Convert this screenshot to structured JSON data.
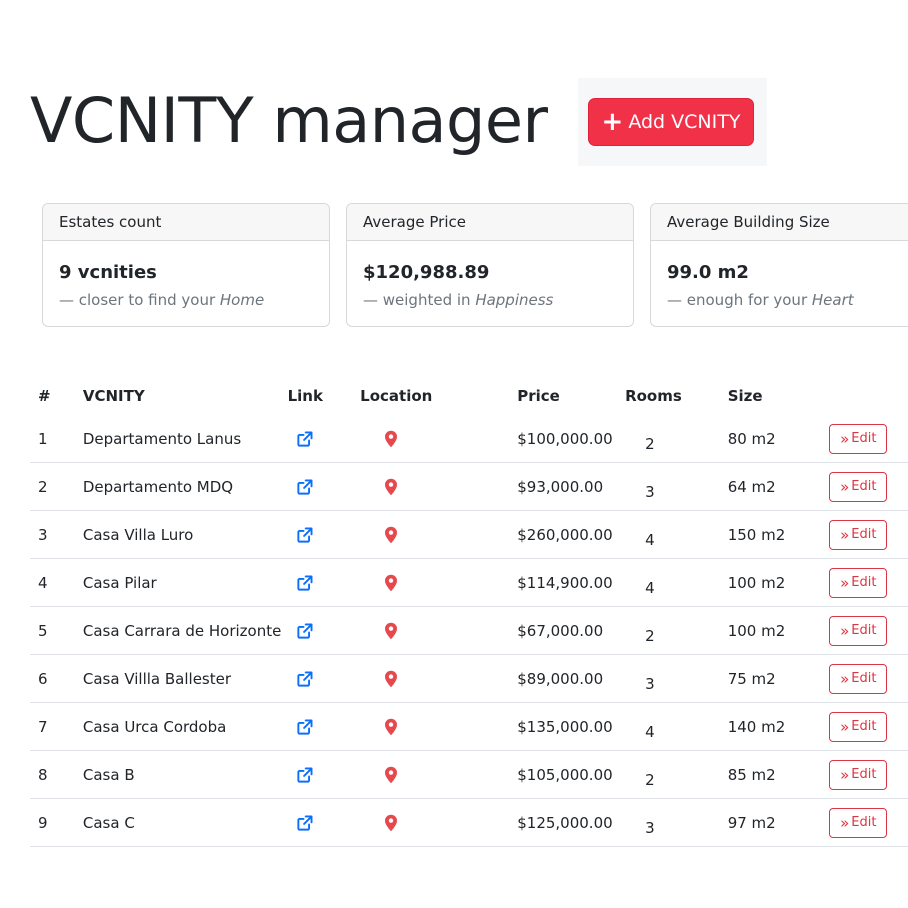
{
  "header": {
    "title": "VCNITY manager",
    "add_button_label": "Add VCNITY"
  },
  "stats": [
    {
      "title": "Estates count",
      "value": "9 vcnities",
      "sub_prefix": "— closer to find your ",
      "sub_em": "Home"
    },
    {
      "title": "Average Price",
      "value": "$120,988.89",
      "sub_prefix": "— weighted in ",
      "sub_em": "Happiness"
    },
    {
      "title": "Average Building Size",
      "value": "99.0 m2",
      "sub_prefix": "— enough for your ",
      "sub_em": "Heart"
    }
  ],
  "table": {
    "columns": [
      "#",
      "VCNITY",
      "Link",
      "Location",
      "Price",
      "Rooms",
      "Size"
    ],
    "edit_label": "Edit",
    "rows": [
      {
        "num": "1",
        "name": "Departamento Lanus",
        "price": "$100,000.00",
        "rooms": "2",
        "size": "80 m2"
      },
      {
        "num": "2",
        "name": "Departamento MDQ",
        "price": "$93,000.00",
        "rooms": "3",
        "size": "64 m2"
      },
      {
        "num": "3",
        "name": "Casa Villa Luro",
        "price": "$260,000.00",
        "rooms": "4",
        "size": "150 m2"
      },
      {
        "num": "4",
        "name": "Casa Pilar",
        "price": "$114,900.00",
        "rooms": "4",
        "size": "100 m2"
      },
      {
        "num": "5",
        "name": "Casa Carrara de Horizonte",
        "price": "$67,000.00",
        "rooms": "2",
        "size": "100 m2"
      },
      {
        "num": "6",
        "name": "Casa Villla Ballester",
        "price": "$89,000.00",
        "rooms": "3",
        "size": "75 m2"
      },
      {
        "num": "7",
        "name": "Casa Urca Cordoba",
        "price": "$135,000.00",
        "rooms": "4",
        "size": "140 m2"
      },
      {
        "num": "8",
        "name": "Casa B",
        "price": "$105,000.00",
        "rooms": "2",
        "size": "85 m2"
      },
      {
        "num": "9",
        "name": "Casa C",
        "price": "$125,000.00",
        "rooms": "3",
        "size": "97 m2"
      }
    ]
  },
  "icons": {
    "add": "plus-icon",
    "link": "external-link-icon",
    "location": "map-pin-icon",
    "edit": "double-chevron-right-icon"
  },
  "colors": {
    "primary_red": "#f03148",
    "danger": "#dc3545",
    "link_blue": "#0d6efd",
    "pin_red": "#e5484d",
    "muted": "#6c757d"
  }
}
